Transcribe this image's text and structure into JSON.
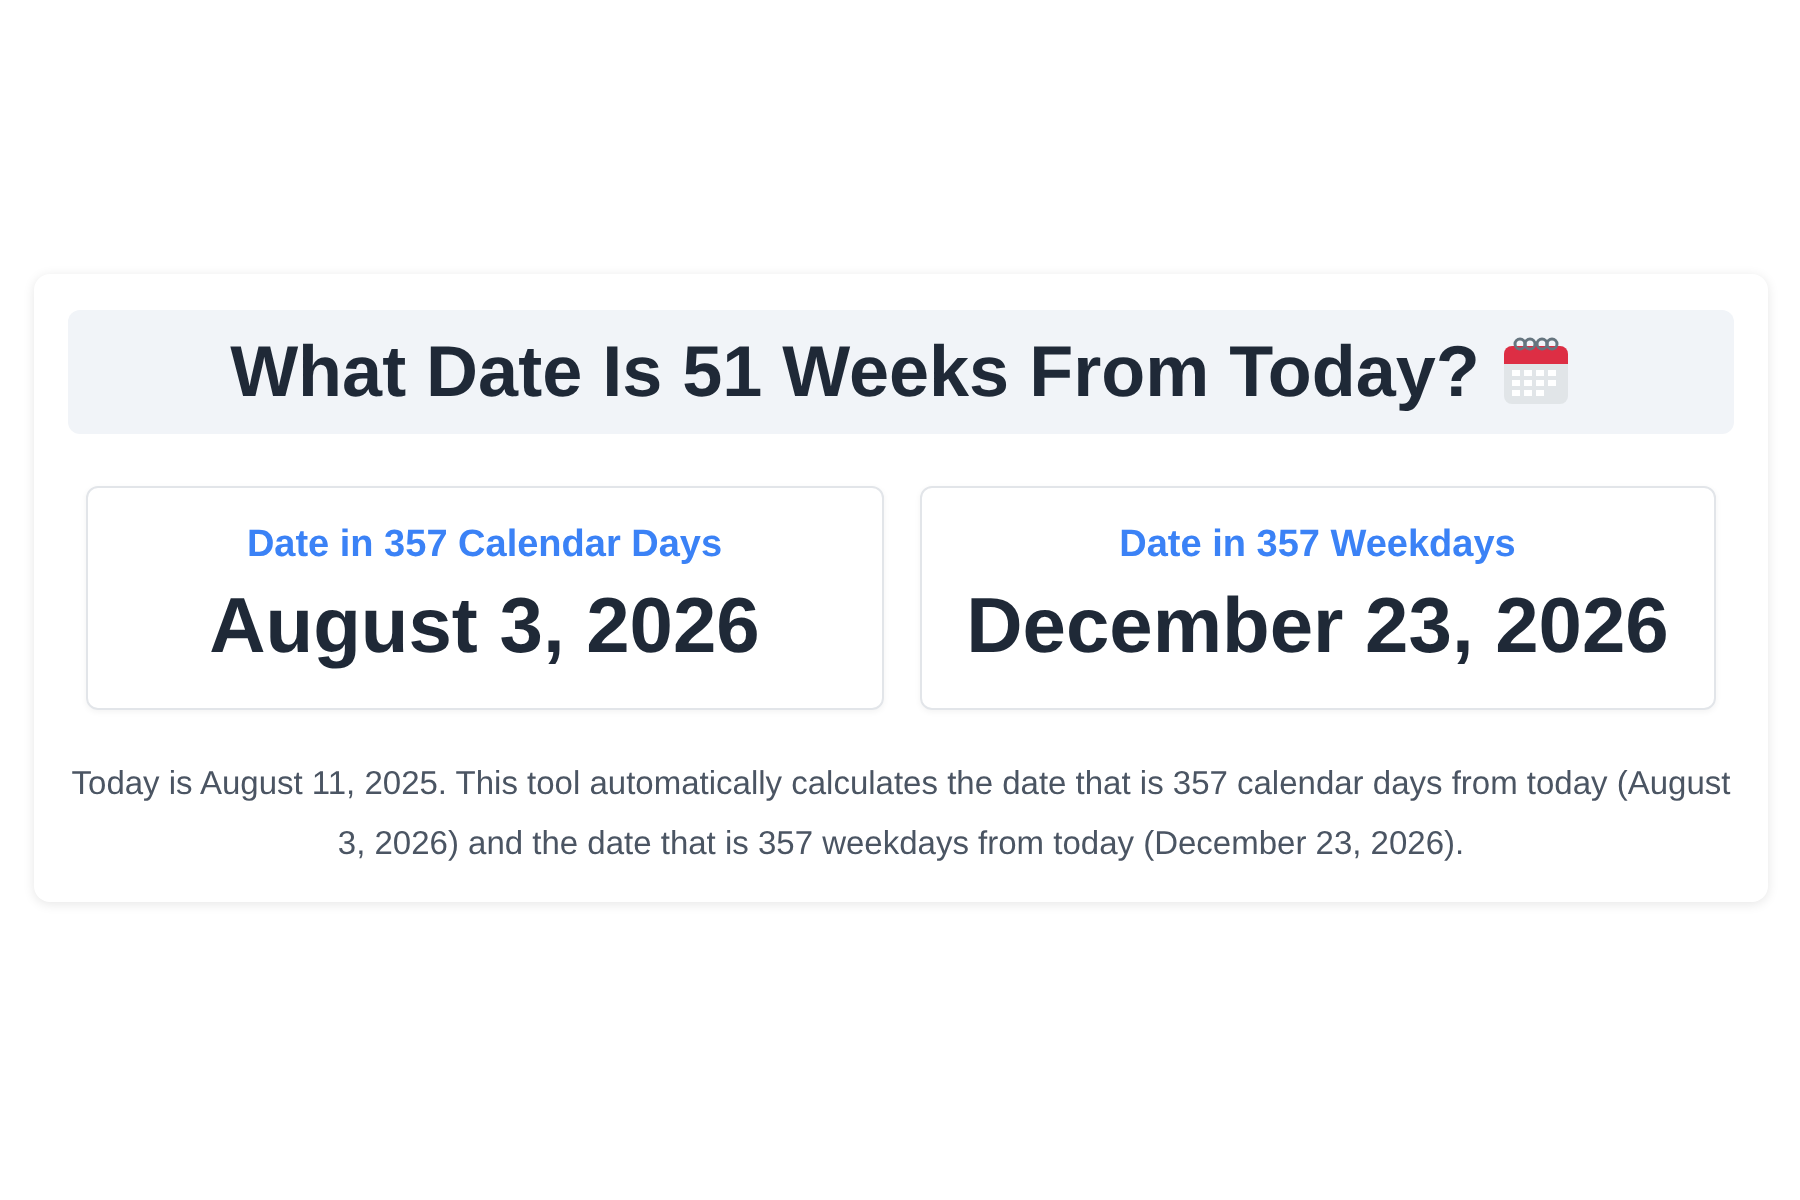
{
  "title": "What Date Is 51 Weeks From Today?",
  "results": [
    {
      "label": "Date in 357 Calendar Days",
      "date": "August 3, 2026"
    },
    {
      "label": "Date in 357 Weekdays",
      "date": "December 23, 2026"
    }
  ],
  "description": "Today is August 11, 2025. This tool automatically calculates the date that is 357 calendar days from today (August 3, 2026) and the date that is 357 weekdays from today (December 23, 2026)."
}
